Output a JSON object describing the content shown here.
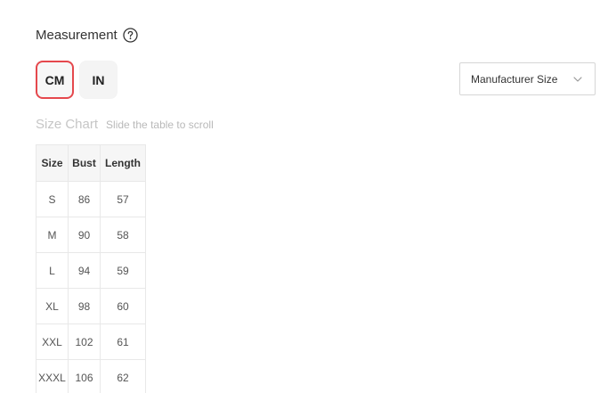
{
  "measurement": {
    "label": "Measurement",
    "help_icon": "question-circle-icon"
  },
  "units": {
    "options": [
      "CM",
      "IN"
    ],
    "selected": "CM",
    "accent_color": "#e5484d"
  },
  "size_select": {
    "value": "Manufacturer Size",
    "icon": "chevron-down-icon"
  },
  "size_chart": {
    "title": "Size Chart",
    "hint": "Slide the table to scroll",
    "headers": [
      "Size",
      "Bust",
      "Length"
    ],
    "rows": [
      [
        "S",
        "86",
        "57"
      ],
      [
        "M",
        "90",
        "58"
      ],
      [
        "L",
        "94",
        "59"
      ],
      [
        "XL",
        "98",
        "60"
      ],
      [
        "XXL",
        "102",
        "61"
      ],
      [
        "XXXL",
        "106",
        "62"
      ]
    ]
  }
}
